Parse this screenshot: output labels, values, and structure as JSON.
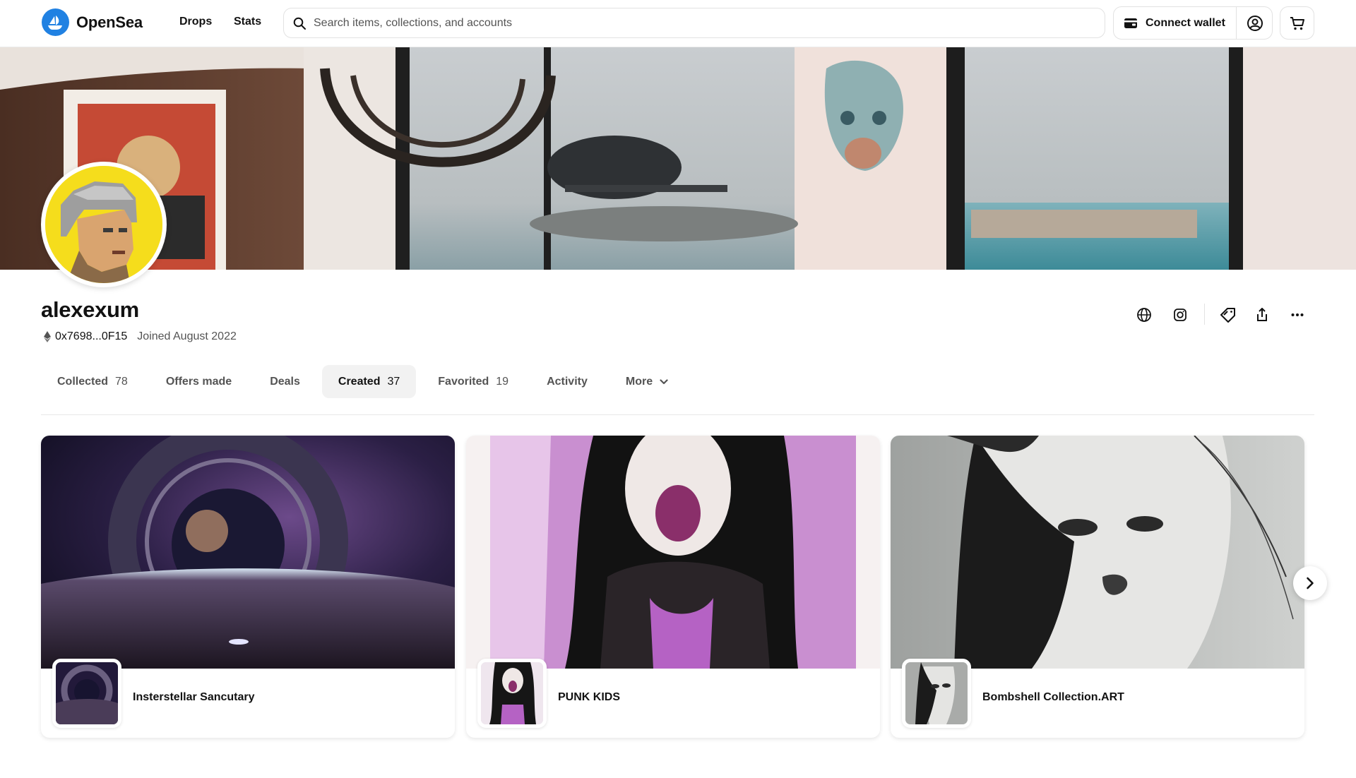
{
  "header": {
    "logo_text": "OpenSea",
    "nav": [
      "Drops",
      "Stats"
    ],
    "search_placeholder": "Search items, collections, and accounts",
    "connect_wallet": "Connect wallet",
    "icons": [
      "search-icon",
      "wallet-icon",
      "account-icon",
      "cart-icon"
    ]
  },
  "profile": {
    "username": "alexexum",
    "address": "0x7698...0F15",
    "joined": "Joined August 2022",
    "actions": [
      "globe-icon",
      "instagram-icon",
      "offers-icon",
      "share-icon",
      "more-icon"
    ]
  },
  "tabs": [
    {
      "label": "Collected",
      "count": "78"
    },
    {
      "label": "Offers made",
      "count": ""
    },
    {
      "label": "Deals",
      "count": ""
    },
    {
      "label": "Created",
      "count": "37",
      "active": true
    },
    {
      "label": "Favorited",
      "count": "19"
    },
    {
      "label": "Activity",
      "count": ""
    },
    {
      "label": "More",
      "count": ""
    }
  ],
  "collections": [
    {
      "name": "Insterstellar Sancutary"
    },
    {
      "name": "PUNK KIDS"
    },
    {
      "name": "Bombshell Collection.ART"
    }
  ],
  "colors": {
    "brand": "#2081e2",
    "text": "#121212",
    "muted": "#545454",
    "avatar_bg": "#f5dd1c"
  }
}
